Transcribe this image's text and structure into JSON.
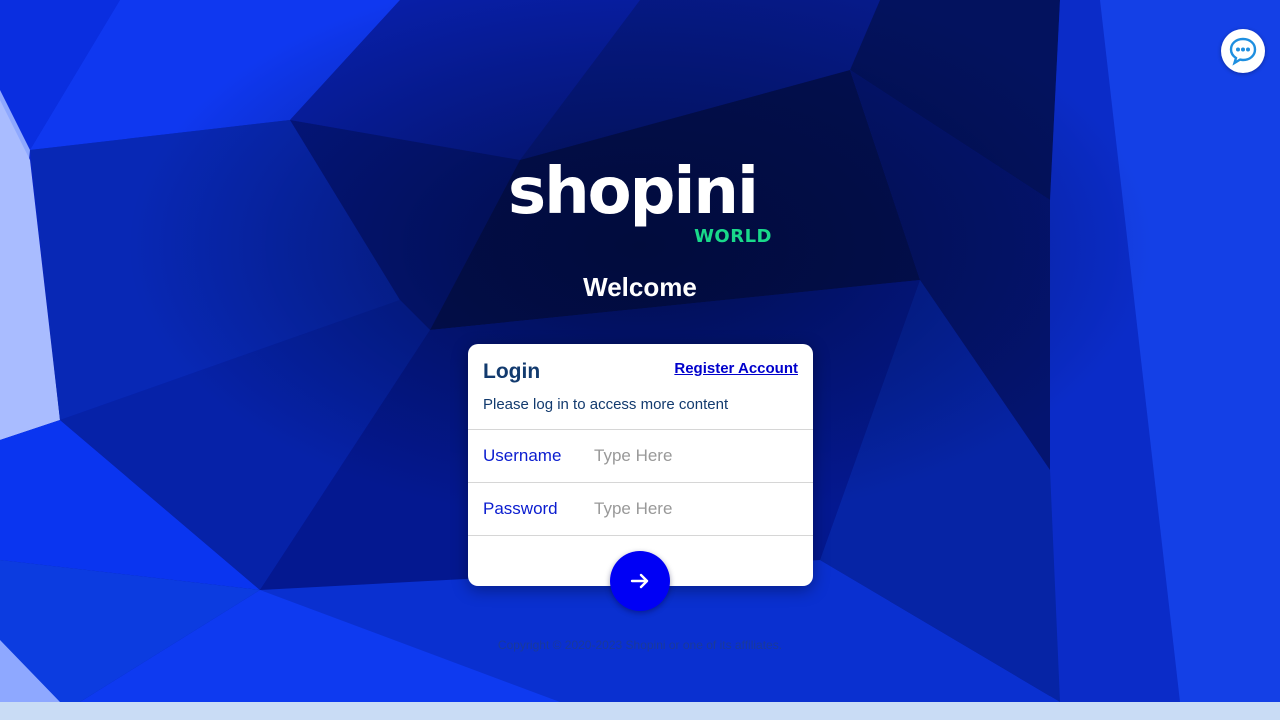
{
  "brand": {
    "name": "shopini",
    "subname": "WORLD",
    "primary_color": "#0000f5",
    "accent_color": "#19d98a"
  },
  "welcome": "Welcome",
  "login": {
    "title": "Login",
    "register_label": "Register Account",
    "subtitle": "Please log in to access more content",
    "username_label": "Username",
    "username_placeholder": "Type Here",
    "username_value": "",
    "password_label": "Password",
    "password_placeholder": "Type Here",
    "password_value": "",
    "submit_icon": "arrow-right-icon"
  },
  "chat": {
    "icon": "chat-bubble-icon"
  },
  "footer": {
    "copyright": "Copyright © 2020-2023 Shopini or one of its affiliates."
  }
}
